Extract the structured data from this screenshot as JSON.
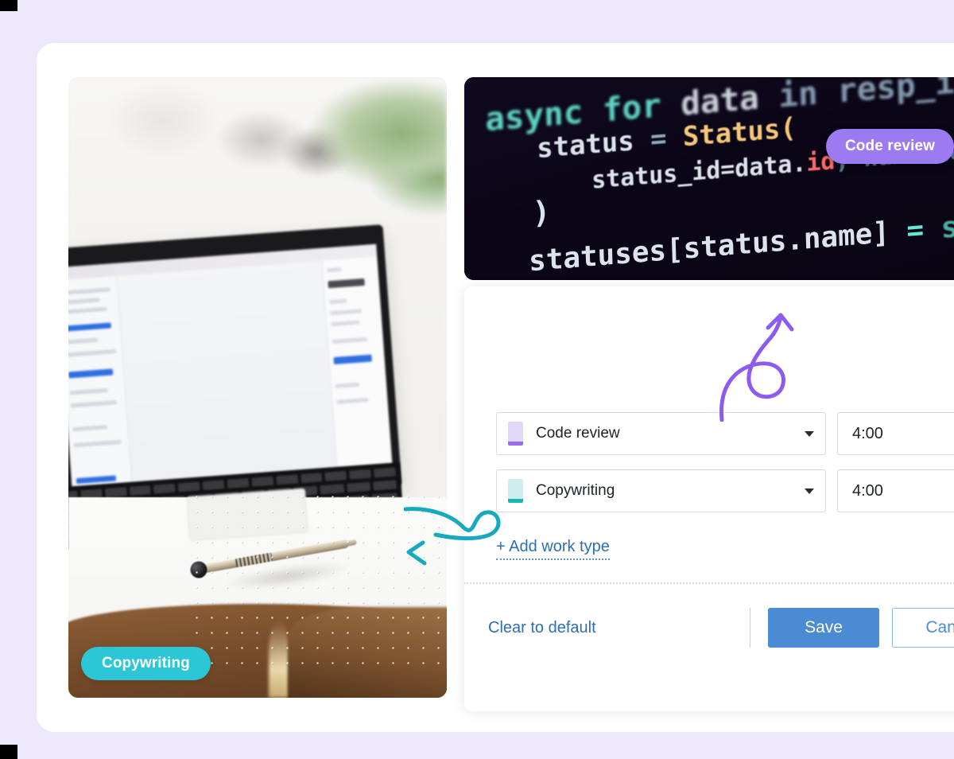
{
  "theme": {
    "page_background": "#EDE8FC",
    "card_background": "#FFFFFF",
    "accent_purple": "#9C7BF2",
    "accent_teal": "#2CC6D6",
    "accent_blue": "#4A8BD4",
    "link_blue": "#2F6DB5"
  },
  "photo_panel": {
    "alt": "Blurred photo of a laptop, pen and open notebook on a desk",
    "badge": {
      "label": "Copywriting",
      "color": "#2CC6D6"
    }
  },
  "code_panel": {
    "alt": "Close-up photo of source code on a dark editor screen",
    "badge": {
      "label": "Code review",
      "color": "#9C7BF2"
    },
    "code_lines": [
      {
        "id": "l1",
        "text": "async for data in resp_iter:"
      },
      {
        "id": "l2",
        "text": "status = Status("
      },
      {
        "id": "l3",
        "text": "status_id=data.id, name=data."
      },
      {
        "id": "l4",
        "text": ")"
      },
      {
        "id": "l5",
        "text": "statuses[status.name] = status"
      }
    ],
    "tokens": {
      "async": "async",
      "for": "for",
      "data": "data",
      "in": "in",
      "resp_iter": "resp_iter:",
      "status": "status",
      "equals": "=",
      "Status": "Status",
      "open_paren": "(",
      "status_id": "status_id=data.",
      "id": "id",
      "comma_name": ", name=data.",
      "close_paren": ")",
      "statuses": "statuses[status.name]",
      "eq2": "=",
      "status2": "status"
    }
  },
  "form": {
    "rows": [
      {
        "swatch_color": "#9C68F0",
        "swatch_class": "purple",
        "work_type": "Code review",
        "time": "4:00"
      },
      {
        "swatch_color": "#17B6B6",
        "swatch_class": "teal",
        "work_type": "Copywriting",
        "time": "4:00"
      }
    ],
    "add_work_type_label": "+ Add work type",
    "footer": {
      "clear_label": "Clear to default",
      "save_label": "Save",
      "cancel_label": "Cancel"
    }
  },
  "annotations": {
    "purple_arrow": "curved-arrow-pointing-up-to-code-review-badge",
    "teal_arrow": "curved-arrow-pointing-left-to-copywriting-photo"
  }
}
